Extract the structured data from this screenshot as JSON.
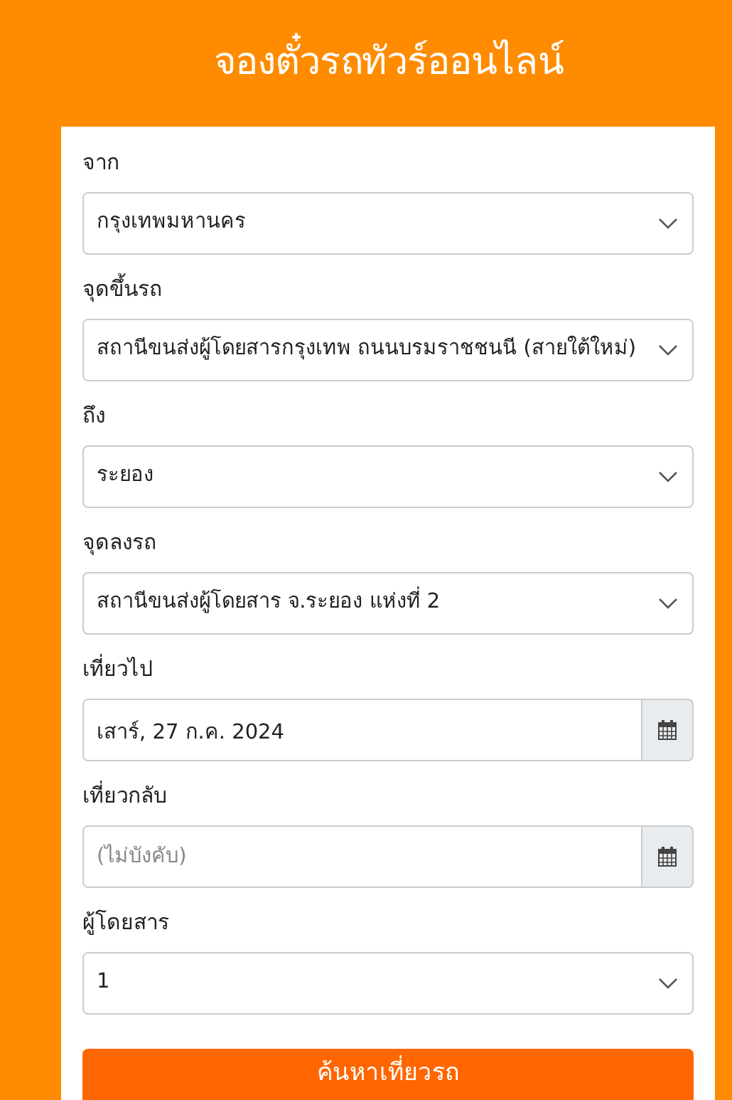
{
  "title": "จองตั๋วรถทัวร์ออนไลน์",
  "fields": [
    {
      "kind": "select",
      "label": "จาก",
      "value": "กรุงเทพมหานคร"
    },
    {
      "kind": "select",
      "label": "จุดขึ้นรถ",
      "value": "สถานีขนส่งผู้โดยสารกรุงเทพ ถนนบรมราชชนนี (สายใต้ใหม่)"
    },
    {
      "kind": "select",
      "label": "ถึง",
      "value": "ระยอง"
    },
    {
      "kind": "select",
      "label": "จุดลงรถ",
      "value": "สถานีขนส่งผู้โดยสาร จ.ระยอง แห่งที่ 2"
    },
    {
      "kind": "date",
      "label": "เที่ยวไป",
      "value": "เสาร์, 27 ก.ค. 2024"
    },
    {
      "kind": "date",
      "label": "เที่ยวกลับ",
      "placeholder": "(ไม่บังคับ)"
    },
    {
      "kind": "select",
      "label": "ผู้โดยสาร",
      "value": "1"
    }
  ],
  "search_button": "ค้นหาเที่ยวรถ"
}
